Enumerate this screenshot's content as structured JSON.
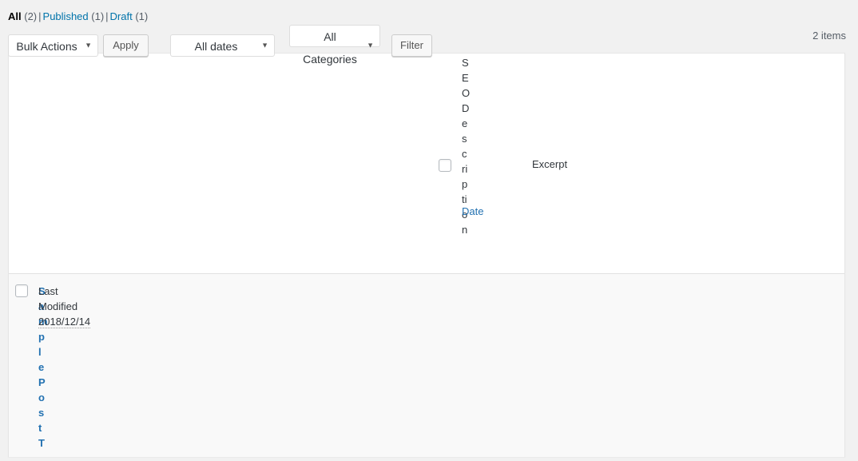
{
  "views": {
    "items": [
      {
        "label": "All",
        "count": "(2)",
        "current": true
      },
      {
        "label": "Published",
        "count": "(1)",
        "current": false
      },
      {
        "label": "Draft",
        "count": "(1)",
        "current": false
      }
    ],
    "separator": "|"
  },
  "tablenav": {
    "bulk_actions": {
      "value": "Bulk Actions",
      "arrow": "▼"
    },
    "apply_label": "Apply",
    "all_dates": {
      "value": "All dates",
      "arrow": "▼"
    },
    "all_categories": {
      "value": "All Categories",
      "arrow": "▼"
    },
    "filter_label": "Filter",
    "displaying_num": "2 items"
  },
  "table": {
    "header_row": {
      "seo_description_column": "SEODescription",
      "date_column": "Date",
      "excerpt_column": "Excerpt"
    },
    "rows": [
      {
        "title": "SamplePostT",
        "last_modified_label_line1": "Last",
        "last_modified_label_line2": "Modified",
        "last_modified_date": "2018/12/14"
      }
    ]
  },
  "colors": {
    "link": "#0073aa",
    "link_alt": "#2271b1",
    "page_bg": "#f1f1f1",
    "row_alt_bg": "#f9f9f9",
    "border": "#e5e5e5",
    "text": "#32373c",
    "muted": "#555d66"
  }
}
